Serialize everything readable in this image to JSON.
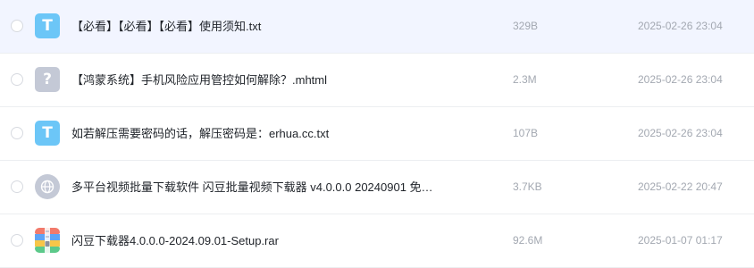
{
  "files": [
    {
      "name": "【必看】【必看】【必看】使用须知.txt",
      "size": "329B",
      "date": "2025-02-26 23:04",
      "icon": "txt-file-icon",
      "icon_glyph": "T"
    },
    {
      "name": "【鸿蒙系统】手机风险应用管控如何解除？.mhtml",
      "size": "2.3M",
      "date": "2025-02-26 23:04",
      "icon": "unknown-file-icon",
      "icon_glyph": "?"
    },
    {
      "name": "如若解压需要密码的话，解压密码是：erhua.cc.txt",
      "size": "107B",
      "date": "2025-02-26 23:04",
      "icon": "txt-file-icon",
      "icon_glyph": "T"
    },
    {
      "name": "多平台视频批量下载软件 闪豆批量视频下载器 v4.0.0.0 20240901 免…",
      "size": "3.7KB",
      "date": "2025-02-22 20:47",
      "icon": "web-link-icon"
    },
    {
      "name": "闪豆下载器4.0.0.0-2024.09.01-Setup.rar",
      "size": "92.6M",
      "date": "2025-01-07 01:17",
      "icon": "rar-archive-icon"
    }
  ],
  "colors": {
    "hover_row": "#f2f5ff",
    "txt_icon": "#6cc6f7",
    "unknown_icon": "#c4c9d6",
    "meta_text": "#a3a8b1"
  }
}
